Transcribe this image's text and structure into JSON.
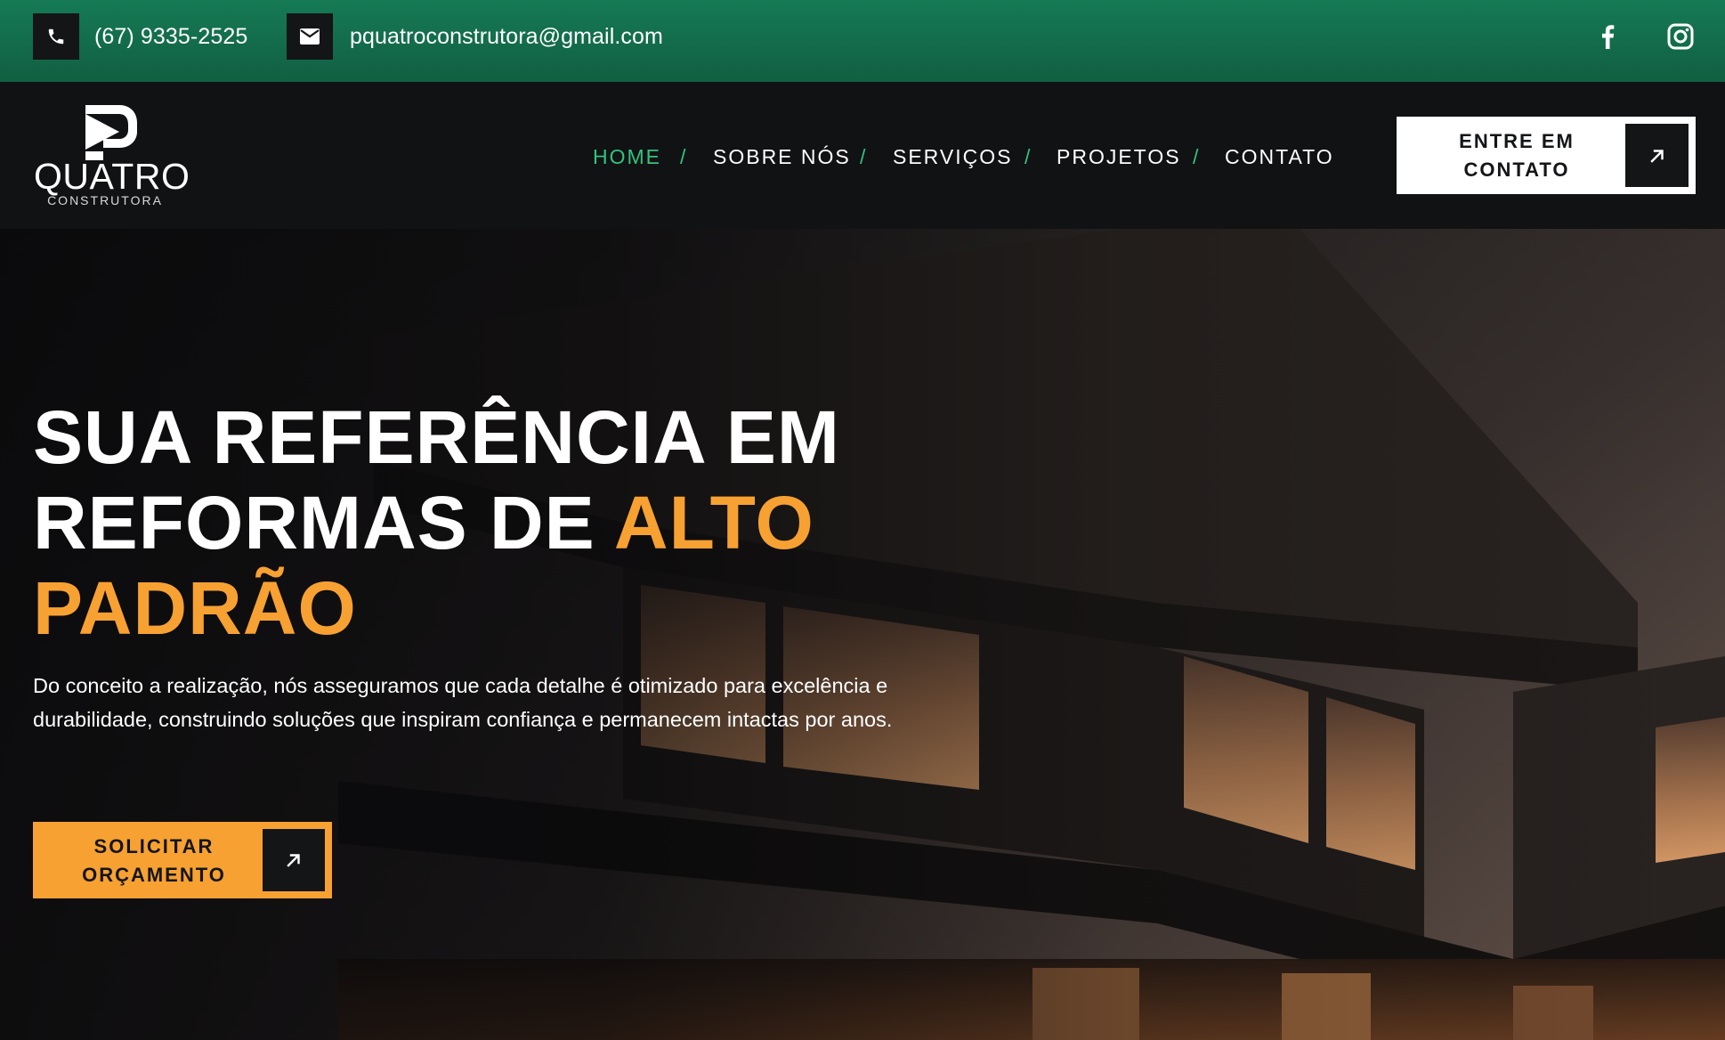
{
  "topbar": {
    "phone": "(67) 9335-2525",
    "phone_icon": "phone-icon",
    "email": "pquatroconstrutora@gmail.com",
    "email_icon": "mail-icon",
    "social": [
      "facebook-icon",
      "instagram-icon"
    ]
  },
  "header": {
    "logo": {
      "wordmark": "QUATRO",
      "subtitle": "CONSTRUTORA"
    },
    "nav": {
      "items": [
        {
          "label": "HOME",
          "active": true
        },
        {
          "label": "SOBRE NÓS",
          "active": false
        },
        {
          "label": "SERVIÇOS",
          "active": false
        },
        {
          "label": "PROJETOS",
          "active": false
        },
        {
          "label": "CONTATO",
          "active": false
        }
      ],
      "separator": "/"
    },
    "cta": {
      "line1": "ENTRE EM",
      "line2": "CONTATO",
      "icon": "arrow-up-right-icon"
    }
  },
  "hero": {
    "title_line1": "SUA REFERÊNCIA EM",
    "title_line2_prefix": "REFORMAS DE ",
    "title_line2_accent": "ALTO",
    "title_line3_accent": "PADRÃO",
    "description": "Do conceito a realização, nós asseguramos que cada detalhe é otimizado para excelência e durabilidade, construindo soluções que inspiram confiança e permanecem intactas por anos.",
    "cta": {
      "line1": "SOLICITAR",
      "line2": "ORÇAMENTO",
      "icon": "arrow-up-right-icon"
    }
  },
  "colors": {
    "topbar_green": "#157a55",
    "accent_green": "#33c37f",
    "accent_orange": "#f7a132",
    "dark": "#111214",
    "white": "#ffffff"
  }
}
